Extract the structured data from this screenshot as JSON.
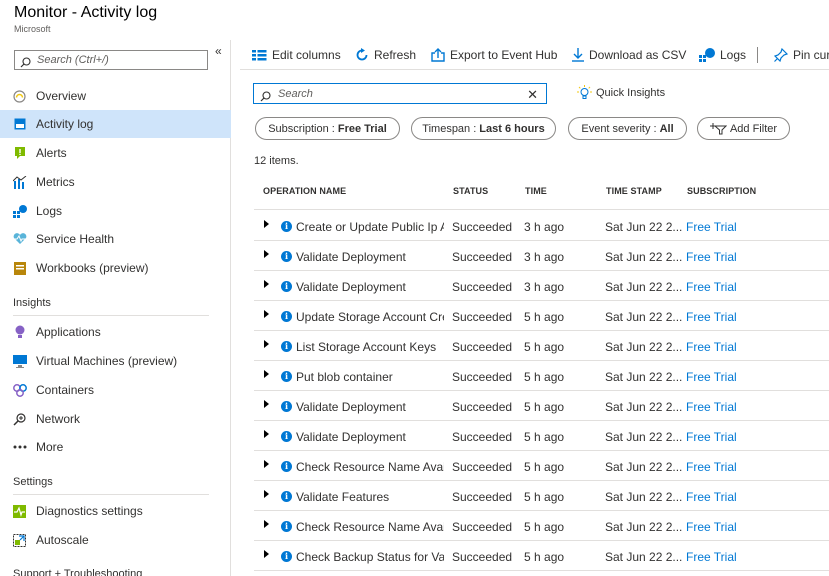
{
  "header": {
    "title": "Monitor - Activity log",
    "subtitle": "Microsoft"
  },
  "sidebar": {
    "collapse_glyph": "«",
    "search_placeholder": "Search (Ctrl+/)",
    "items": [
      {
        "label": "Overview",
        "icon": "overview-icon"
      },
      {
        "label": "Activity log",
        "icon": "activity-log-icon",
        "active": true
      },
      {
        "label": "Alerts",
        "icon": "alerts-icon"
      },
      {
        "label": "Metrics",
        "icon": "metrics-icon"
      },
      {
        "label": "Logs",
        "icon": "logs-icon"
      },
      {
        "label": "Service Health",
        "icon": "service-health-icon"
      },
      {
        "label": "Workbooks (preview)",
        "icon": "workbooks-icon"
      }
    ],
    "insights_header": "Insights",
    "insights_items": [
      {
        "label": "Applications",
        "icon": "applications-icon"
      },
      {
        "label": "Virtual Machines (preview)",
        "icon": "virtual-machines-icon"
      },
      {
        "label": "Containers",
        "icon": "containers-icon"
      },
      {
        "label": "Network",
        "icon": "network-icon"
      },
      {
        "label": "More",
        "icon": "more-icon"
      }
    ],
    "settings_header": "Settings",
    "settings_items": [
      {
        "label": "Diagnostics settings",
        "icon": "diagnostics-icon"
      },
      {
        "label": "Autoscale",
        "icon": "autoscale-icon"
      }
    ],
    "support_header": "Support + Troubleshooting"
  },
  "toolbar": {
    "edit_columns": "Edit columns",
    "refresh": "Refresh",
    "export": "Export to Event Hub",
    "download": "Download as CSV",
    "logs": "Logs",
    "pin": "Pin cur"
  },
  "search": {
    "placeholder": "Search",
    "clear": "✕"
  },
  "quick_insights": "Quick Insights",
  "filters": {
    "subscription": {
      "label": "Subscription :",
      "value": "Free Trial"
    },
    "timespan": {
      "label": "Timespan :",
      "value": "Last 6 hours"
    },
    "severity": {
      "label": "Event severity :",
      "value": "All"
    },
    "add_filter": "Add Filter"
  },
  "item_count": "12 items.",
  "table": {
    "headers": [
      "OPERATION NAME",
      "STATUS",
      "TIME",
      "TIME STAMP",
      "SUBSCRIPTION"
    ],
    "rows": [
      {
        "op": "Create or Update Public Ip A",
        "status": "Succeeded",
        "time": "3 h ago",
        "stamp": "Sat Jun 22 2...",
        "sub": "Free Trial"
      },
      {
        "op": "Validate Deployment",
        "status": "Succeeded",
        "time": "3 h ago",
        "stamp": "Sat Jun 22 2...",
        "sub": "Free Trial"
      },
      {
        "op": "Validate Deployment",
        "status": "Succeeded",
        "time": "3 h ago",
        "stamp": "Sat Jun 22 2...",
        "sub": "Free Trial"
      },
      {
        "op": "Update Storage Account Cre",
        "status": "Succeeded",
        "time": "5 h ago",
        "stamp": "Sat Jun 22 2...",
        "sub": "Free Trial"
      },
      {
        "op": "List Storage Account Keys",
        "status": "Succeeded",
        "time": "5 h ago",
        "stamp": "Sat Jun 22 2...",
        "sub": "Free Trial"
      },
      {
        "op": "Put blob container",
        "status": "Succeeded",
        "time": "5 h ago",
        "stamp": "Sat Jun 22 2...",
        "sub": "Free Trial"
      },
      {
        "op": "Validate Deployment",
        "status": "Succeeded",
        "time": "5 h ago",
        "stamp": "Sat Jun 22 2...",
        "sub": "Free Trial"
      },
      {
        "op": "Validate Deployment",
        "status": "Succeeded",
        "time": "5 h ago",
        "stamp": "Sat Jun 22 2...",
        "sub": "Free Trial"
      },
      {
        "op": "Check Resource Name Availa",
        "status": "Succeeded",
        "time": "5 h ago",
        "stamp": "Sat Jun 22 2...",
        "sub": "Free Trial"
      },
      {
        "op": "Validate Features",
        "status": "Succeeded",
        "time": "5 h ago",
        "stamp": "Sat Jun 22 2...",
        "sub": "Free Trial"
      },
      {
        "op": "Check Resource Name Availa",
        "status": "Succeeded",
        "time": "5 h ago",
        "stamp": "Sat Jun 22 2...",
        "sub": "Free Trial"
      },
      {
        "op": "Check Backup Status for Vau",
        "status": "Succeeded",
        "time": "5 h ago",
        "stamp": "Sat Jun 22 2...",
        "sub": "Free Trial"
      }
    ]
  },
  "colors": {
    "accent": "#0078d4",
    "active_nav": "#cfe4fa",
    "divider": "#e1dfdd"
  }
}
